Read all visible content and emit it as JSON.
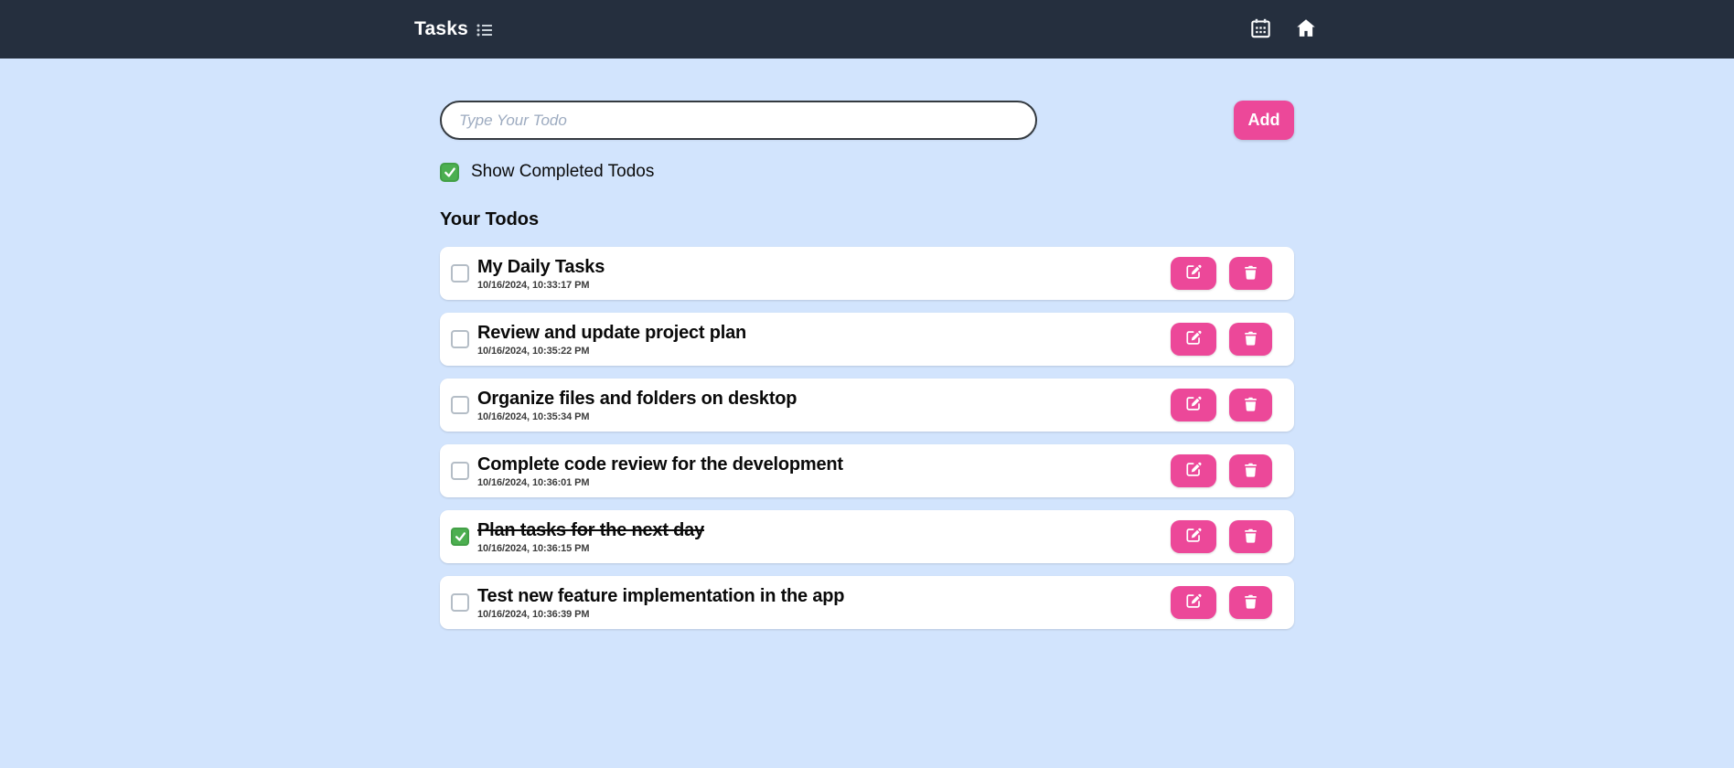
{
  "header": {
    "title": "Tasks",
    "brand_icon": "list-ul-icon",
    "right_icons": [
      "calendar-days-icon",
      "home-icon"
    ]
  },
  "composer": {
    "placeholder": "Type Your Todo",
    "add_label": "Add"
  },
  "filter": {
    "label": "Show Completed Todos",
    "checked": true
  },
  "list": {
    "heading": "Your Todos",
    "todos": [
      {
        "title": "My Daily Tasks",
        "timestamp": "10/16/2024, 10:33:17 PM",
        "completed": false
      },
      {
        "title": "Review and update project plan",
        "timestamp": "10/16/2024, 10:35:22 PM",
        "completed": false
      },
      {
        "title": "Organize files and folders on desktop",
        "timestamp": "10/16/2024, 10:35:34 PM",
        "completed": false
      },
      {
        "title": "Complete code review for the development",
        "timestamp": "10/16/2024, 10:36:01 PM",
        "completed": false
      },
      {
        "title": "Plan tasks for the next day",
        "timestamp": "10/16/2024, 10:36:15 PM",
        "completed": true
      },
      {
        "title": "Test new feature implementation in the app",
        "timestamp": "10/16/2024, 10:36:39 PM",
        "completed": false
      }
    ]
  },
  "colors": {
    "header_bg": "#252f3e",
    "page_bg": "#d2e4fd",
    "accent_pink": "#ec4899",
    "checkbox_green": "#4caf50"
  }
}
